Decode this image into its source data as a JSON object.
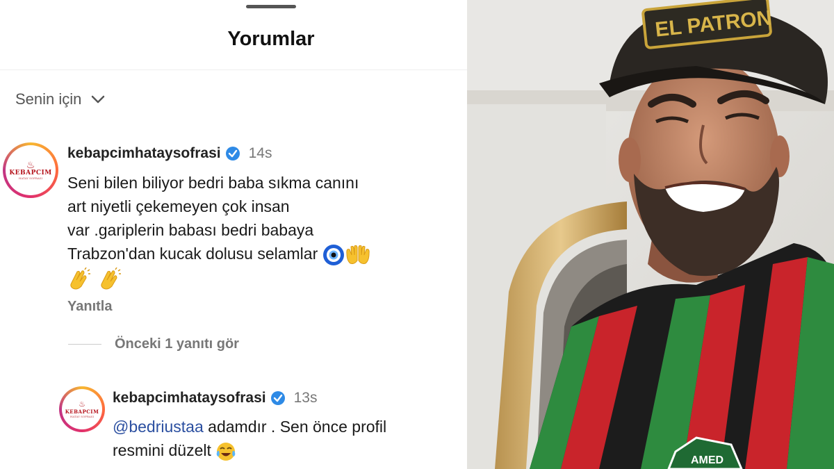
{
  "header": {
    "title": "Yorumlar"
  },
  "sort": {
    "label": "Senin için"
  },
  "comments": [
    {
      "username": "kebapcimhataysofrasi",
      "time": "14s",
      "lines": [
        "Seni bilen biliyor bedri baba sıkma canını",
        "art niyetli çekemeyen çok insan",
        "var .gariplerin babası bedri babaya",
        "Trabzon'dan kucak dolusu selamlar"
      ],
      "reply_label": "Yanıtla"
    }
  ],
  "view_previous": "Önceki 1 yanıtı gör",
  "reply": {
    "username": "kebapcimhataysofrasi",
    "time": "13s",
    "mention": "@bedriustaa",
    "line1_rest": " adamdır . Sen önce profil",
    "line2": "resmini düzelt"
  },
  "avatar": {
    "brand": "KEBAPCIM",
    "sub": "HATAY SOFRASI"
  },
  "photo": {
    "cap_text": "EL PATRON",
    "badge_text": "AMED"
  },
  "colors": {
    "verify": "#2e8ae6",
    "text_muted": "#777777",
    "mention": "#2b4fa0",
    "jersey_red": "#c9242b",
    "jersey_green": "#2e8b3f"
  }
}
